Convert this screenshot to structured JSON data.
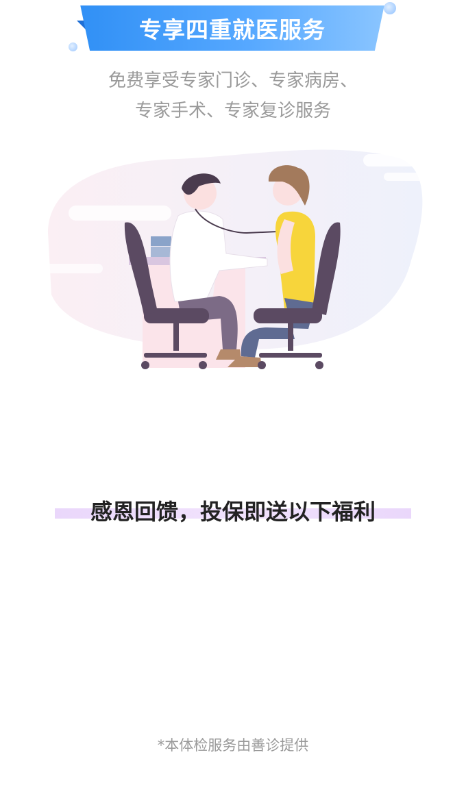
{
  "banner": {
    "title": "专享四重就医服务"
  },
  "subtitle": {
    "line1": "免费享受专家门诊、专家病房、",
    "line2": "专家手术、专家复诊服务"
  },
  "illustration": {
    "name": "doctor-consultation-illustration"
  },
  "benefits": {
    "heading": "感恩回馈，投保即送以下福利"
  },
  "footnote": {
    "text": "*本体检服务由善诊提供"
  },
  "colors": {
    "banner_start": "#2f8ff5",
    "banner_end": "#8cc6ff",
    "highlight": "#ead7fb",
    "muted_text": "#9a9a9a",
    "heading_text": "#222222"
  }
}
